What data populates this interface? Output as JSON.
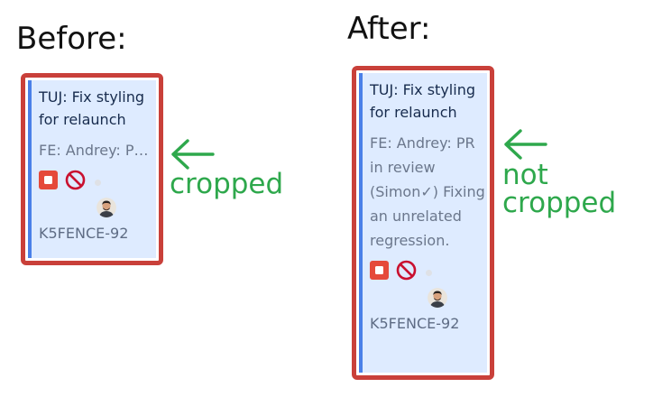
{
  "before": {
    "heading": "Before:",
    "card": {
      "title": "TUJ: Fix styling for relaunch",
      "description": "FE: Andrey: PR in review (Simon✓) Fixing an unrelated regression.",
      "key": "K5FENCE-92"
    },
    "note": "cropped"
  },
  "after": {
    "heading": "After:",
    "card": {
      "title": "TUJ: Fix styling for relaunch",
      "description": "FE: Andrey: PR in review (Simon✓) Fixing an unrelated regression.",
      "key": "K5FENCE-92"
    },
    "note_line1": "not",
    "note_line2": "cropped"
  },
  "icons": [
    "priority-highest-icon",
    "blocked-icon",
    "status-dot-icon",
    "avatar-icon",
    "arrow-left-icon"
  ],
  "colors": {
    "frame_border": "#c9403a",
    "card_bg": "#deebff",
    "card_accent": "#4a80e8",
    "annotation": "#2ea84c"
  }
}
